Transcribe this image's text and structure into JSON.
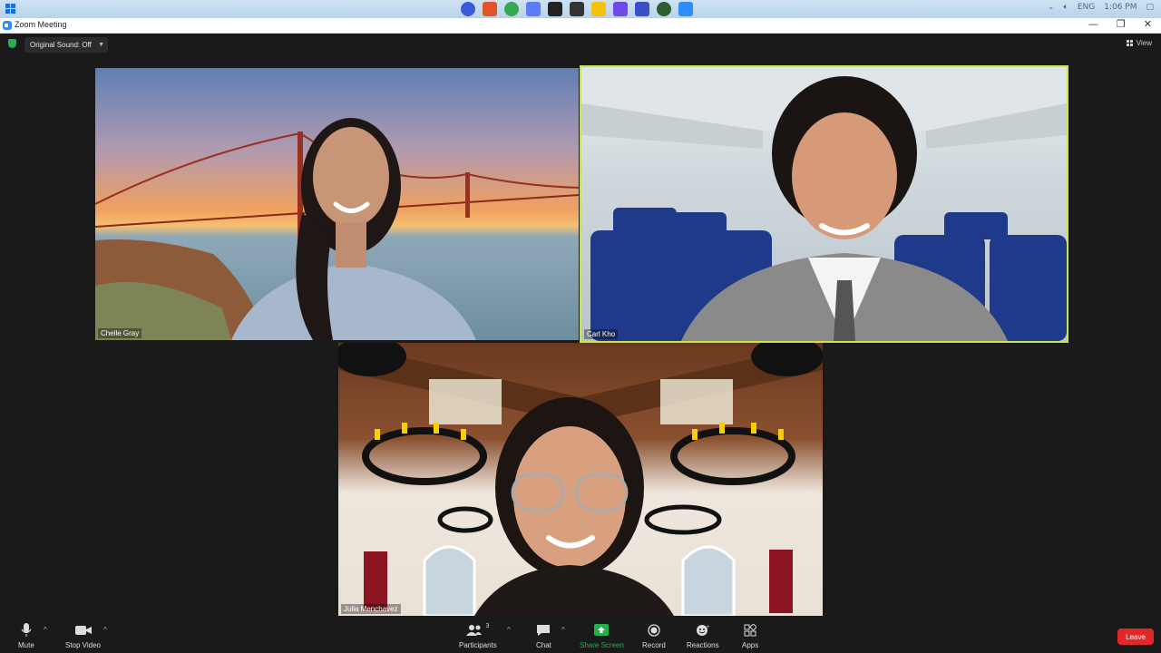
{
  "taskbar": {
    "tray_lang": "ENG",
    "tray_time": "1:06 PM"
  },
  "window": {
    "title": "Zoom Meeting",
    "minimize": "—",
    "restore": "❐",
    "close": "✕"
  },
  "meeting_header": {
    "original_sound_label": "Original Sound: Off",
    "view_label": "View"
  },
  "participants": [
    {
      "name": "Chelle Gray",
      "active_speaker": false
    },
    {
      "name": "Carl Kho",
      "active_speaker": true
    },
    {
      "name": "Julia Menchavez",
      "active_speaker": false
    }
  ],
  "toolbar": {
    "mute_label": "Mute",
    "stop_video_label": "Stop Video",
    "participants_label": "Participants",
    "participants_count": "3",
    "chat_label": "Chat",
    "share_screen_label": "Share Screen",
    "record_label": "Record",
    "reactions_label": "Reactions",
    "apps_label": "Apps",
    "leave_label": "Leave"
  },
  "colors": {
    "active_speaker_border": "#c8e64a",
    "share_screen": "#23b14d",
    "leave": "#e02828",
    "zoom_blue": "#2d8cff"
  }
}
